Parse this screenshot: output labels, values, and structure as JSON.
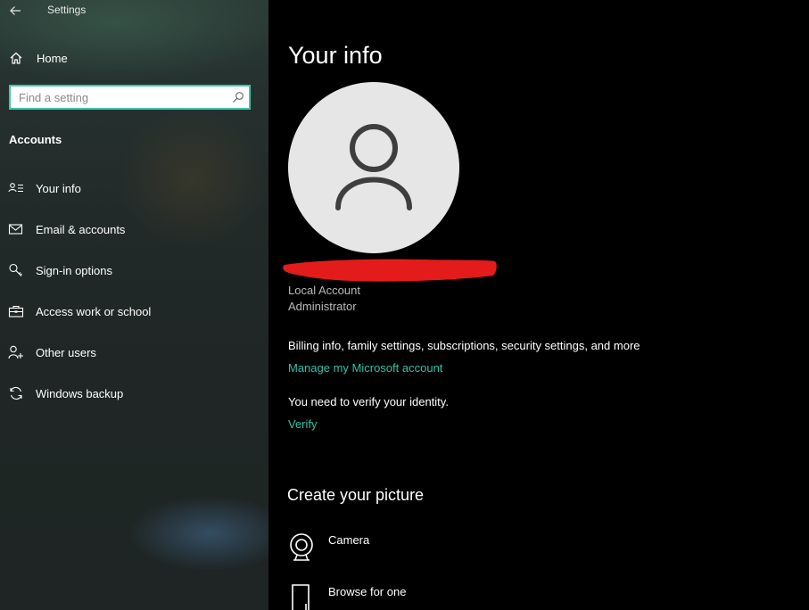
{
  "window": {
    "title": "Settings",
    "back_icon": "back-arrow-icon"
  },
  "sidebar": {
    "home_label": "Home",
    "home_icon": "home-icon",
    "search": {
      "placeholder": "Find a setting",
      "value": "",
      "icon": "search-icon"
    },
    "section_title": "Accounts",
    "items": [
      {
        "label": "Your info",
        "icon": "contact-card-icon",
        "selected": true
      },
      {
        "label": "Email & accounts",
        "icon": "mail-icon",
        "selected": false
      },
      {
        "label": "Sign-in options",
        "icon": "key-icon",
        "selected": false
      },
      {
        "label": "Access work or school",
        "icon": "briefcase-icon",
        "selected": false
      },
      {
        "label": "Other users",
        "icon": "add-person-icon",
        "selected": false
      },
      {
        "label": "Windows backup",
        "icon": "sync-icon",
        "selected": false
      }
    ]
  },
  "main": {
    "title": "Your info",
    "avatar_icon": "user-silhouette-icon",
    "account_type": "Local Account",
    "account_role": "Administrator",
    "billing_text": "Billing info, family settings, subscriptions, security settings, and more",
    "manage_link": "Manage my Microsoft account",
    "verify_text": "You need to verify your identity.",
    "verify_link": "Verify",
    "picture_heading": "Create your picture",
    "picture_options": [
      {
        "label": "Camera",
        "icon": "camera-icon"
      },
      {
        "label": "Browse for one",
        "icon": "browse-file-icon"
      }
    ]
  },
  "colors": {
    "accent": "#2fc3a7",
    "search_border": "#3ec6ae",
    "redaction": "#e41b1b",
    "avatar_bg": "#e6e6e6",
    "main_bg": "#000000"
  }
}
